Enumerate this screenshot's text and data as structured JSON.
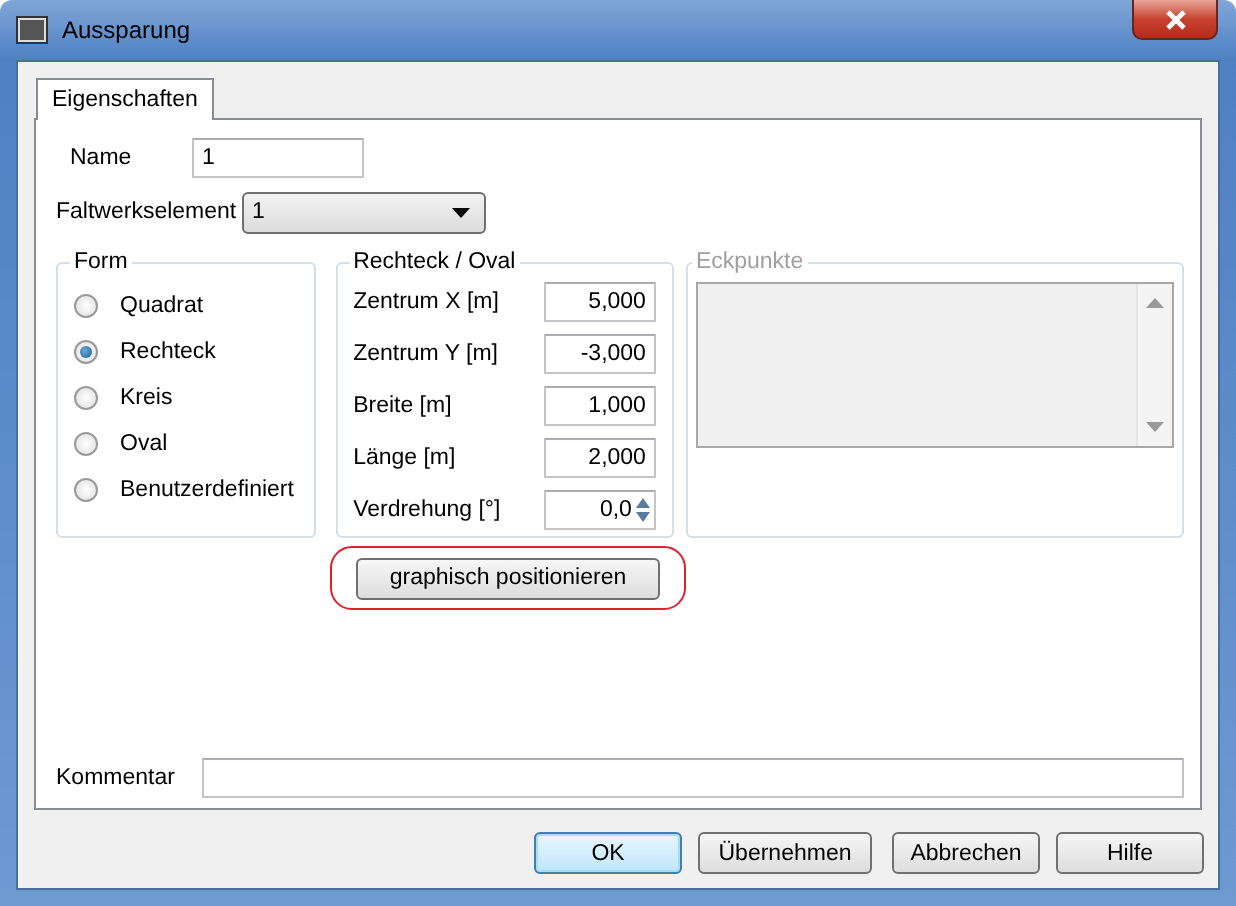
{
  "window": {
    "title": "Aussparung"
  },
  "tabs": [
    {
      "label": "Eigenschaften",
      "selected": true
    }
  ],
  "name": {
    "label": "Name",
    "value": "1"
  },
  "element": {
    "label": "Faltwerkselement",
    "value": "1"
  },
  "form": {
    "title": "Form",
    "options": [
      {
        "label": "Quadrat",
        "selected": false
      },
      {
        "label": "Rechteck",
        "selected": true
      },
      {
        "label": "Kreis",
        "selected": false
      },
      {
        "label": "Oval",
        "selected": false
      },
      {
        "label": "Benutzerdefiniert",
        "selected": false
      }
    ]
  },
  "rect": {
    "title": "Rechteck / Oval",
    "fields": [
      {
        "label": "Zentrum X [m]",
        "value": "5,000",
        "kind": "text"
      },
      {
        "label": "Zentrum Y [m]",
        "value": "-3,000",
        "kind": "text"
      },
      {
        "label": "Breite [m]",
        "value": "1,000",
        "kind": "text"
      },
      {
        "label": "Länge [m]",
        "value": "2,000",
        "kind": "text"
      },
      {
        "label": "Verdrehung [°]",
        "value": "0,0",
        "kind": "spin"
      }
    ]
  },
  "corners": {
    "title": "Eckpunkte",
    "disabled": true
  },
  "position_button": {
    "label": "graphisch positionieren",
    "highlighted": true
  },
  "comment": {
    "label": "Kommentar"
  },
  "buttons": [
    {
      "label": "OK",
      "default": true
    },
    {
      "label": "Übernehmen",
      "default": false
    },
    {
      "label": "Abbrechen",
      "default": false
    },
    {
      "label": "Hilfe",
      "default": false
    }
  ]
}
